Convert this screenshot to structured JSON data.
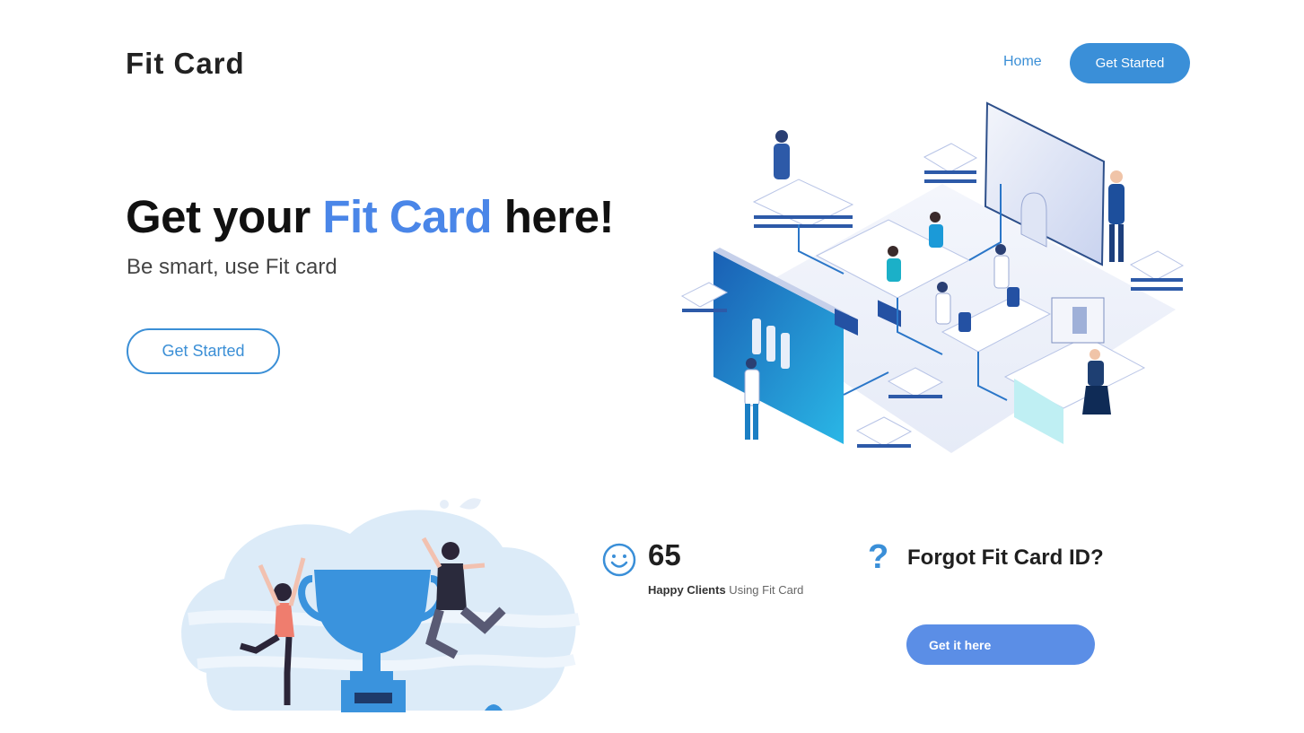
{
  "header": {
    "brand": "Fit Card",
    "nav_home": "Home",
    "nav_cta": "Get Started"
  },
  "hero": {
    "title_prefix": "Get your ",
    "title_accent": "Fit Card",
    "title_suffix": " here!",
    "subtitle": "Be smart, use Fit card",
    "cta": "Get Started",
    "illustration_icon": "isometric-lab-office-illustration"
  },
  "stats": {
    "icon": "smile-icon",
    "number": "65",
    "caption_bold": "Happy Clients",
    "caption_rest": " Using Fit Card"
  },
  "forgot": {
    "icon": "question-icon",
    "title": "Forgot Fit Card ID?",
    "button": "Get it here"
  },
  "trophy": {
    "illustration_icon": "trophy-celebration-illustration"
  },
  "colors": {
    "accent": "#4a86e8",
    "primary_button": "#3a8fd8",
    "secondary_button": "#5b8ee6"
  }
}
